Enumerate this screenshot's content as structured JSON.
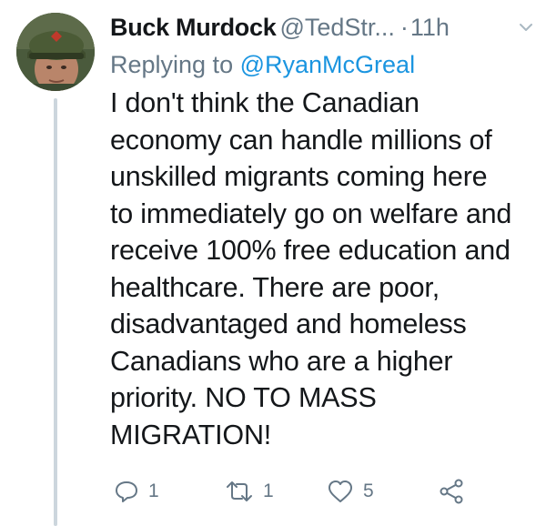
{
  "tweet": {
    "display_name": "Buck Murdock",
    "handle": "@TedStr...",
    "separator": "·",
    "time": "11h",
    "reply_prefix": "Replying to",
    "reply_to": "@RyanMcGreal",
    "text_lines": [
      "I don't think the Canadian",
      "economy can handle millions of",
      "unskilled migrants coming here",
      "to immediately go on welfare and",
      "receive 100% free education and",
      "healthcare. There are poor,",
      "disadvantaged and homeless",
      "Canadians who are a higher",
      "priority. NO TO MASS",
      "MIGRATION!"
    ],
    "actions": {
      "reply_count": "1",
      "retweet_count": "1",
      "like_count": "5"
    }
  },
  "icons": {
    "avatar": "profile-photo",
    "caret": "chevron-down-icon",
    "reply": "reply-icon",
    "retweet": "retweet-icon",
    "like": "heart-icon",
    "share": "share-icon"
  },
  "colors": {
    "text": "#14171a",
    "secondary": "#657786",
    "link": "#1b95e0",
    "thread_line": "#ccd6dd"
  }
}
